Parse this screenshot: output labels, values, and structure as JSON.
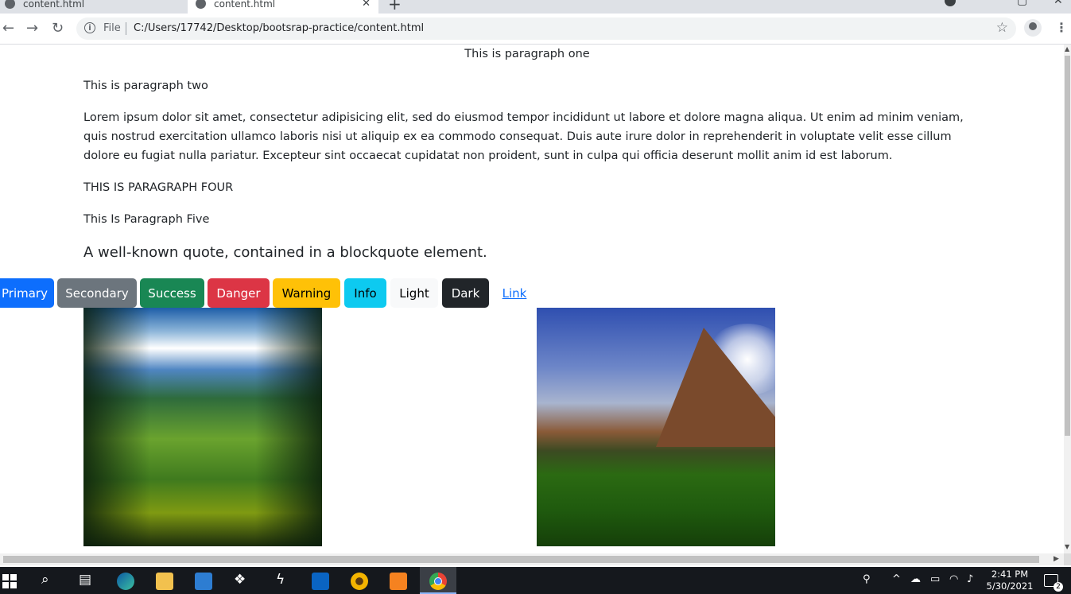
{
  "browser": {
    "tabs": [
      {
        "title": "content.html"
      },
      {
        "title": "content.html"
      }
    ],
    "new_tab_symbol": "+",
    "address_scheme_label": "File",
    "address_url": "C:/Users/17742/Desktop/bootsrap-practice/content.html"
  },
  "page": {
    "para_one": "This is paragraph one",
    "para_two": "This is paragraph two",
    "lorem": "Lorem ipsum dolor sit amet, consectetur adipisicing elit, sed do eiusmod tempor incididunt ut labore et dolore magna aliqua. Ut enim ad minim veniam, quis nostrud exercitation ullamco laboris nisi ut aliquip ex ea commodo consequat. Duis aute irure dolor in reprehenderit in voluptate velit esse cillum dolore eu fugiat nulla pariatur. Excepteur sint occaecat cupidatat non proident, sunt in culpa qui officia deserunt mollit anim id est laborum.",
    "para_four": "THIS IS PARAGRAPH FOUR",
    "para_five": "This Is Paragraph Five",
    "blockquote": "A well-known quote, contained in a blockquote element.",
    "buttons": {
      "primary": "Primary",
      "secondary": "Secondary",
      "success": "Success",
      "danger": "Danger",
      "warning": "Warning",
      "info": "Info",
      "light": "Light",
      "dark": "Dark",
      "link": "Link"
    },
    "images": [
      {
        "alt_icon": "mountain-valley-photo"
      },
      {
        "alt_icon": "mountain-meadow-photo"
      }
    ]
  },
  "taskbar": {
    "time": "2:41 PM",
    "date": "5/30/2021",
    "notification_count": "2"
  },
  "colors": {
    "primary": "#0d6efd",
    "secondary": "#6c757d",
    "success": "#198754",
    "danger": "#dc3545",
    "warning": "#ffc107",
    "info": "#0dcaf0",
    "light": "#f8f9fa",
    "dark": "#212529"
  }
}
